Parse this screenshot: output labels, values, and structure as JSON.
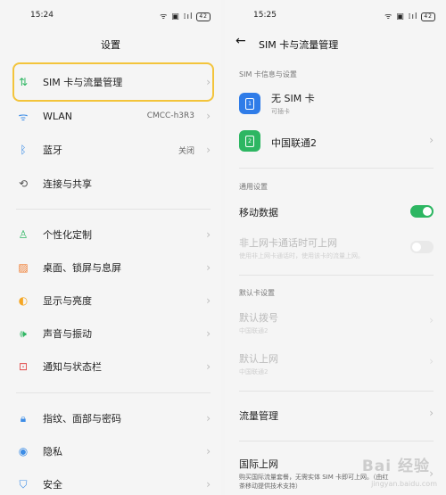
{
  "left": {
    "status_time": "15:24",
    "status_icons": "ᯤ ▣ ⁞ıl",
    "battery": "42",
    "title": "设置",
    "items": [
      {
        "label": "SIM 卡与流量管理",
        "value": ""
      },
      {
        "label": "WLAN",
        "value": "CMCC-h3R3"
      },
      {
        "label": "蓝牙",
        "value": "关闭"
      },
      {
        "label": "连接与共享",
        "value": ""
      },
      {
        "label": "个性化定制",
        "value": ""
      },
      {
        "label": "桌面、锁屏与息屏",
        "value": ""
      },
      {
        "label": "显示与亮度",
        "value": ""
      },
      {
        "label": "声音与振动",
        "value": ""
      },
      {
        "label": "通知与状态栏",
        "value": ""
      },
      {
        "label": "指纹、面部与密码",
        "value": ""
      },
      {
        "label": "隐私",
        "value": ""
      },
      {
        "label": "安全",
        "value": ""
      }
    ],
    "icon_colors": {
      "sim": "#2db662",
      "wlan": "#3d8de6",
      "bluetooth": "#3d8de6",
      "share": "#555555",
      "personal": "#2db662",
      "desktop": "#f07b2e",
      "display": "#f5a623",
      "sound": "#2db662",
      "notify": "#e14a4a",
      "fingerprint": "#3d8de6",
      "privacy": "#3d8de6",
      "security": "#3d8de6"
    }
  },
  "right": {
    "status_time": "15:25",
    "status_icons": "ᯤ ▣ ⁞ıl",
    "battery": "42",
    "title": "SIM 卡与流量管理",
    "section_sim": "SIM 卡信息与设置",
    "sim1_name": "无 SIM 卡",
    "sim1_sub": "可插卡",
    "sim2_name": "中国联通2",
    "section_general": "通用设置",
    "mobile_data": "移动数据",
    "mobile_data_on": true,
    "non_data_call": "非上网卡通话时可上网",
    "non_data_call_sub": "使用非上网卡通话时，使用该卡的流量上网。",
    "section_default": "默认卡设置",
    "default_dial": "默认拨号",
    "default_dial_sub": "中国联通2",
    "default_net": "默认上网",
    "default_net_sub": "中国联通2",
    "traffic": "流量管理",
    "intl": "国际上网",
    "intl_sub": "购买国际流量套餐，无需实体 SIM 卡即可上网。（由红茶移动提供技术支持）",
    "colors": {
      "sim_blue": "#2f7ce8",
      "sim_green": "#2db662"
    }
  },
  "watermark": "Bai 经验",
  "watermark_sub": "jingyan.baidu.com"
}
